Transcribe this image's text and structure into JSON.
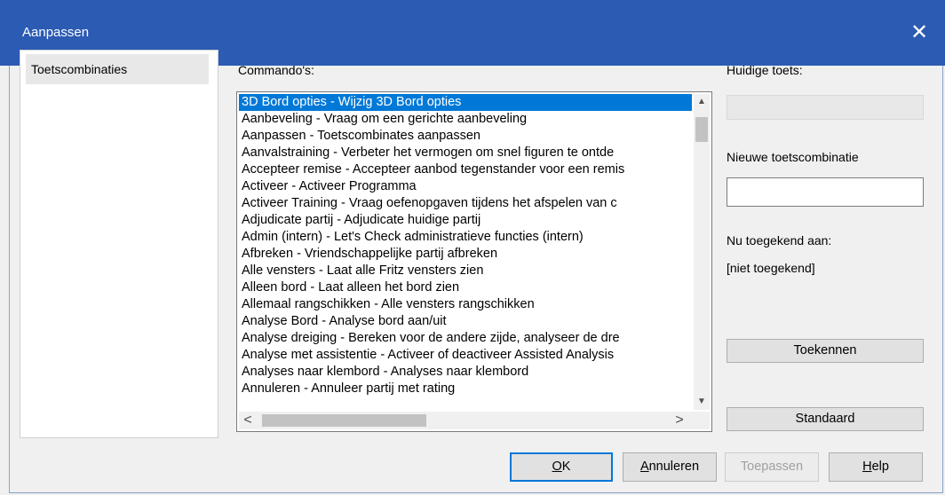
{
  "window": {
    "title": "Aanpassen",
    "close_glyph": "✕"
  },
  "sidebar": {
    "items": [
      {
        "label": "Toetscombinaties"
      }
    ]
  },
  "commands": {
    "label": "Commando's:",
    "selected_index": 0,
    "items": [
      "3D Bord opties - Wijzig 3D Bord opties",
      "Aanbeveling - Vraag om een gerichte aanbeveling",
      "Aanpassen - Toetscombinates aanpassen",
      "Aanvalstraining - Verbeter het vermogen om snel figuren te ontde",
      "Accepteer remise - Accepteer aanbod tegenstander voor een remis",
      "Activeer - Activeer Programma",
      "Activeer Training - Vraag oefenopgaven tijdens het afspelen van c",
      "Adjudicate partij - Adjudicate huidige partij",
      "Admin (intern) - Let's Check administratieve functies (intern)",
      "Afbreken - Vriendschappelijke partij afbreken",
      "Alle vensters - Laat alle Fritz vensters zien",
      "Alleen bord - Laat alleen het bord zien",
      "Allemaal rangschikken - Alle vensters rangschikken",
      "Analyse Bord - Analyse bord aan/uit",
      "Analyse dreiging - Bereken voor de andere zijde, analyseer de dre",
      "Analyse met assistentie - Activeer of deactiveer Assisted Analysis",
      "Analyses naar klembord - Analyses naar klembord",
      "Annuleren - Annuleer partij met rating"
    ],
    "scroll_icons": {
      "up": "▲",
      "down": "▼",
      "left": "<",
      "right": ">"
    }
  },
  "current_key": {
    "label": "Huidige toets:",
    "value": ""
  },
  "new_combination": {
    "label": "Nieuwe toetscombinatie",
    "value": ""
  },
  "assigned_to": {
    "label": "Nu toegekend aan:",
    "value": "[niet toegekend]"
  },
  "buttons": {
    "assign": "Toekennen",
    "default": "Standaard",
    "ok_prefix": "",
    "ok_accel": "O",
    "ok_rest": "K",
    "cancel_accel": "A",
    "cancel_rest": "nnuleren",
    "apply": "Toepassen",
    "help_accel": "H",
    "help_rest": "elp"
  }
}
